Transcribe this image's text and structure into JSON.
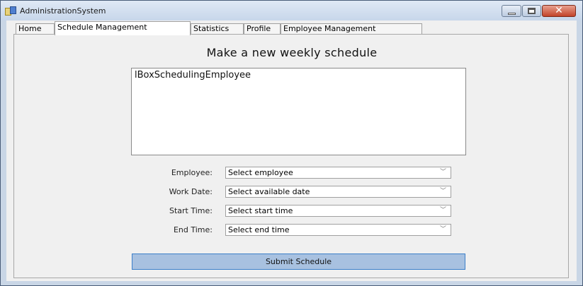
{
  "window": {
    "title": "AdministrationSystem"
  },
  "tabs": [
    {
      "label": "Home"
    },
    {
      "label": "Schedule Management"
    },
    {
      "label": "Statistics"
    },
    {
      "label": "Profile"
    },
    {
      "label": "Employee Management"
    }
  ],
  "schedule": {
    "heading": "Make a new weekly schedule",
    "listbox_text": "lBoxSchedulingEmployee",
    "fields": [
      {
        "label": "Employee:",
        "value": "Select employee"
      },
      {
        "label": "Work Date:",
        "value": "Select available date"
      },
      {
        "label": "Start Time:",
        "value": "Select start time"
      },
      {
        "label": "End Time:",
        "value": "Select end time"
      }
    ],
    "submit_label": "Submit Schedule"
  }
}
